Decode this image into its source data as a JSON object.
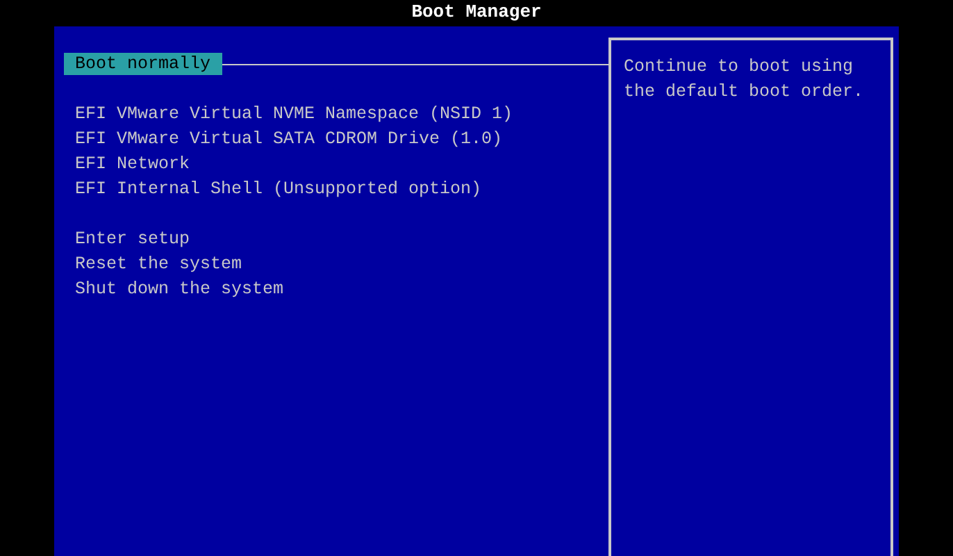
{
  "title": "Boot Manager",
  "menu_groups": [
    [
      {
        "label": "Boot normally",
        "selected": true
      }
    ],
    [
      {
        "label": "EFI VMware Virtual NVME Namespace (NSID 1)",
        "selected": false
      },
      {
        "label": "EFI VMware Virtual SATA CDROM Drive (1.0)",
        "selected": false
      },
      {
        "label": "EFI Network",
        "selected": false
      },
      {
        "label": "EFI Internal Shell (Unsupported option)",
        "selected": false
      }
    ],
    [
      {
        "label": "Enter setup",
        "selected": false
      },
      {
        "label": "Reset the system",
        "selected": false
      },
      {
        "label": "Shut down the system",
        "selected": false
      }
    ]
  ],
  "help": {
    "lines": [
      "Continue to boot using",
      "the default boot order."
    ]
  }
}
